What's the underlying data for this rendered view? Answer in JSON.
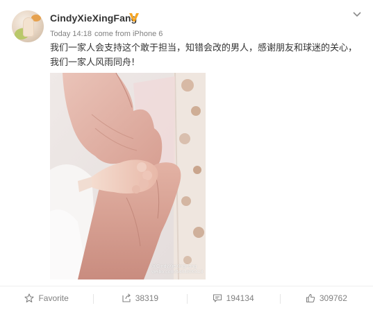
{
  "post": {
    "username": "CindyXieXingFang",
    "verified_icon": "verified-v-badge-icon",
    "timestamp": "Today 14:18",
    "source": "come from iPhone 6",
    "text": "我们一家人会支持这个敢于担当，知错会改的男人，感谢朋友和球迷的关心，我们一家人风雨同舟!",
    "image_watermark_line1": "@CindyXieXingFang",
    "image_watermark_line2": "weibo.com/5484806413"
  },
  "actions": {
    "favorite_label": "Favorite",
    "forward_count": "38319",
    "comment_count": "194134",
    "like_count": "309762"
  },
  "colors": {
    "verified": "#f6a623",
    "text": "#333333",
    "meta": "#808080"
  }
}
